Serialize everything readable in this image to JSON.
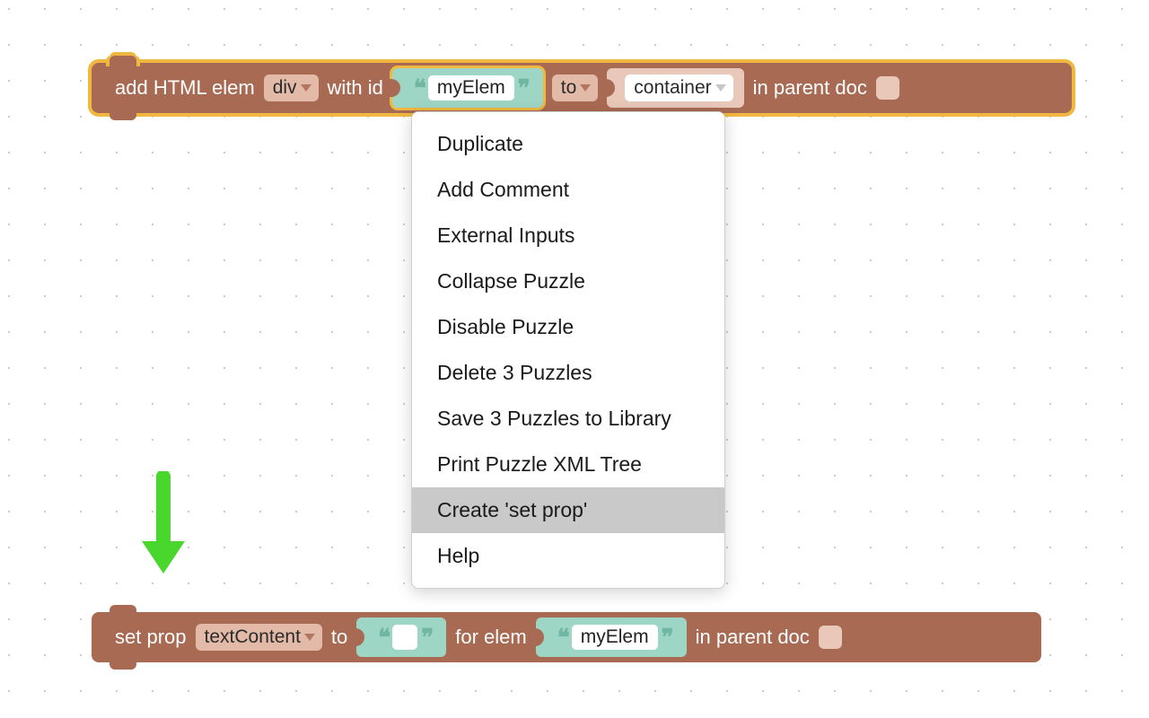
{
  "block1": {
    "t_add": "add HTML elem",
    "elem_type": "div",
    "t_withid": "with id",
    "id_value": "myElem",
    "t_to": "to",
    "target": "container",
    "t_inparent": "in parent doc"
  },
  "block2": {
    "t_setprop": "set prop",
    "prop": "textContent",
    "t_to": "to",
    "value": "",
    "t_forelem": "for elem",
    "elem": "myElem",
    "t_inparent": "in parent doc"
  },
  "menu": {
    "items": [
      "Duplicate",
      "Add Comment",
      "External Inputs",
      "Collapse Puzzle",
      "Disable Puzzle",
      "Delete 3 Puzzles",
      "Save 3 Puzzles to Library",
      "Print Puzzle XML Tree",
      "Create 'set prop'",
      "Help"
    ],
    "hover_index": 8
  }
}
